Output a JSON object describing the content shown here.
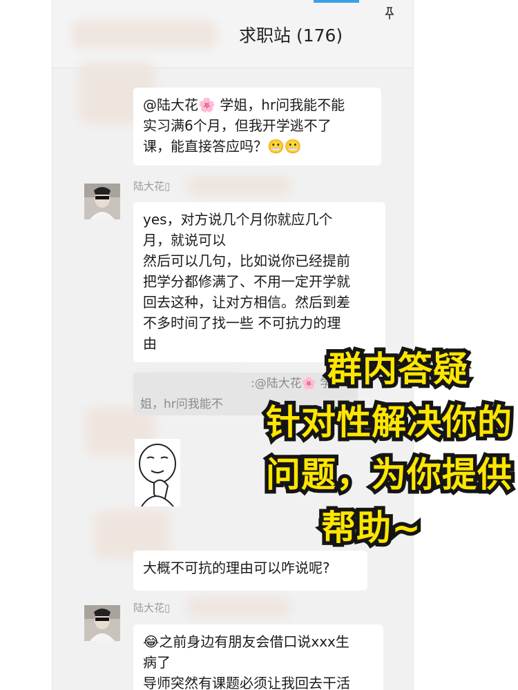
{
  "header": {
    "title": "求职站 (176)",
    "pin_icon": "pin-icon"
  },
  "messages": [
    {
      "lines": [
        "@陆大花🌸 学姐，hr问我能不能",
        "实习满6个月，但我开学逃不了",
        "课，能直接答应吗？😬😬"
      ]
    },
    {
      "sender": "陆大花▯",
      "lines": [
        "yes，对方说几个月你就应几个",
        "月，就说可以",
        "然后可以几句，比如说你已经提前",
        "把学分都修满了、不用一定开学就",
        "回去这种，让对方相信。然后到差",
        "不多时间了找一些 不可抗力的理",
        "由"
      ],
      "quote_lines": [
        ":@陆大花🌸 学",
        "姐，hr问我能不"
      ]
    },
    {
      "sticker": "thinking-face-sticker"
    },
    {
      "lines": [
        "大概不可抗的理由可以咋说呢?"
      ]
    },
    {
      "sender": "陆大花▯",
      "lines": [
        "😂之前身边有朋友会借口说xxx生",
        "病了",
        "导师突然有课题必须让我回去干活"
      ]
    }
  ],
  "overlay": {
    "lines": [
      "群内答疑",
      "针对性解决你的",
      "问题，为你提供",
      "帮助~"
    ],
    "fill_color": "#ffe600",
    "stroke_color": "#151515"
  },
  "colors": {
    "accent": "#3aa0e6",
    "chat_background": "#f1f1f1",
    "bubble": "#ffffff"
  }
}
